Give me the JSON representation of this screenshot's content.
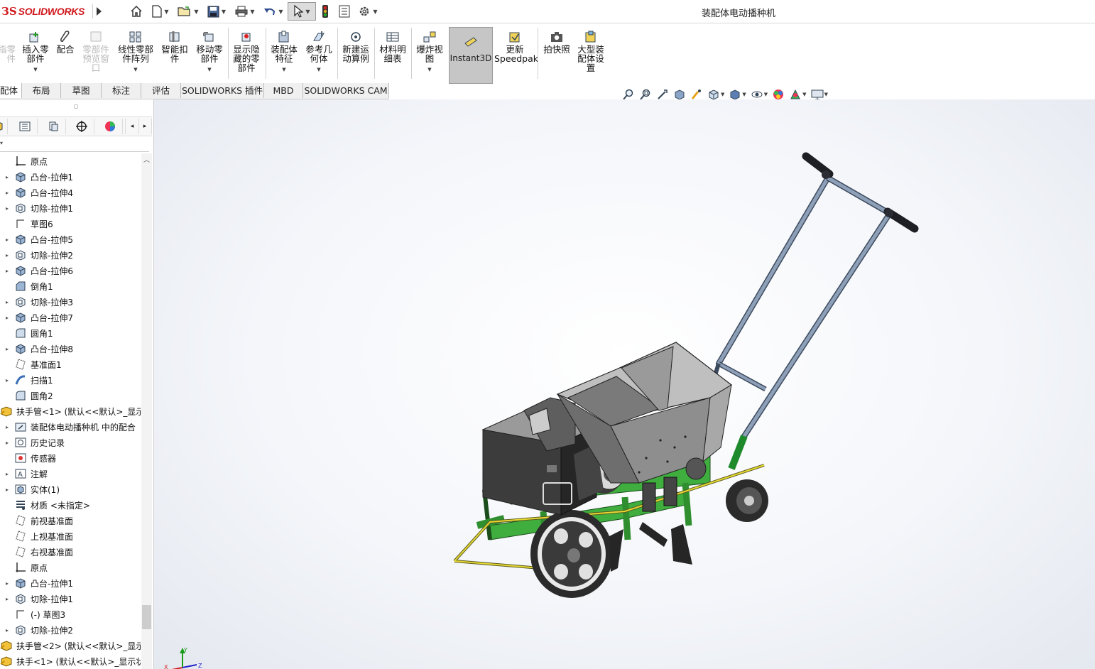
{
  "app": {
    "brand": "SOLIDWORKS",
    "window_title": "装配体电动播种机"
  },
  "colors": {
    "brand_red": "#d0191e",
    "frame_green": "#3fae3f",
    "hopper_gray": "#8e8e8e",
    "handle_blue": "#7d8fa8",
    "instant3d_bg": "#c6c6c6"
  },
  "quick_access": [
    {
      "name": "home-icon"
    },
    {
      "name": "new-document-icon"
    },
    {
      "name": "open-folder-icon"
    },
    {
      "name": "save-icon"
    },
    {
      "name": "print-icon"
    },
    {
      "name": "undo-icon"
    },
    {
      "name": "select-pointer-icon"
    },
    {
      "name": "rebuild-traffic-light-icon"
    },
    {
      "name": "file-properties-icon"
    },
    {
      "name": "options-gear-icon"
    }
  ],
  "ribbon": {
    "items": [
      {
        "label": "插入零部件",
        "lines": [
          "插入零",
          "部件"
        ]
      },
      {
        "label": "配合",
        "lines": [
          "配合"
        ]
      },
      {
        "label": "零部件预览窗口",
        "lines": [
          "零部件",
          "预览窗",
          "口"
        ]
      },
      {
        "label": "线性零部件阵列",
        "lines": [
          "线性零部",
          "件阵列"
        ]
      },
      {
        "label": "智能扣件",
        "lines": [
          "智能扣",
          "件"
        ]
      },
      {
        "label": "移动零部件",
        "lines": [
          "移动零",
          "部件"
        ]
      },
      {
        "label": "显示隐藏的零部件",
        "lines": [
          "显示隐",
          "藏的零",
          "部件"
        ]
      },
      {
        "label": "装配体特征",
        "lines": [
          "装配体",
          "特征"
        ]
      },
      {
        "label": "参考几何体",
        "lines": [
          "参考几",
          "何体"
        ]
      },
      {
        "label": "新建运动算例",
        "lines": [
          "新建运",
          "动算例"
        ]
      },
      {
        "label": "材料明细表",
        "lines": [
          "材料明",
          "细表"
        ]
      },
      {
        "label": "爆炸视图",
        "lines": [
          "爆炸视",
          "图"
        ]
      },
      {
        "label": "Instant3D",
        "lines": [
          "Instant3D"
        ]
      },
      {
        "label": "更新Speedpak",
        "lines": [
          "更新",
          "Speedpak"
        ]
      },
      {
        "label": "拍快照",
        "lines": [
          "拍快照"
        ]
      },
      {
        "label": "大型装配体设置",
        "lines": [
          "大型装",
          "配体设",
          "置"
        ]
      }
    ],
    "cut_left": [
      "指零",
      "件"
    ]
  },
  "tabs": [
    "配体",
    "布局",
    "草图",
    "标注",
    "评估",
    "SOLIDWORKS 插件",
    "MBD",
    "SOLIDWORKS CAM"
  ],
  "tree": {
    "items": [
      {
        "label": "原点",
        "icon": "origin-icon",
        "expand": false,
        "indent": 1
      },
      {
        "label": "凸台-拉伸1",
        "icon": "boss-extrude-icon",
        "expand": true,
        "indent": 1
      },
      {
        "label": "凸台-拉伸4",
        "icon": "boss-extrude-icon",
        "expand": true,
        "indent": 1
      },
      {
        "label": "切除-拉伸1",
        "icon": "cut-extrude-icon",
        "expand": true,
        "indent": 1
      },
      {
        "label": "草图6",
        "icon": "sketch-icon",
        "expand": false,
        "indent": 1
      },
      {
        "label": "凸台-拉伸5",
        "icon": "boss-extrude-icon",
        "expand": true,
        "indent": 1
      },
      {
        "label": "切除-拉伸2",
        "icon": "cut-extrude-icon",
        "expand": true,
        "indent": 1
      },
      {
        "label": "凸台-拉伸6",
        "icon": "boss-extrude-icon",
        "expand": true,
        "indent": 1
      },
      {
        "label": "倒角1",
        "icon": "chamfer-icon",
        "expand": false,
        "indent": 1
      },
      {
        "label": "切除-拉伸3",
        "icon": "cut-extrude-icon",
        "expand": true,
        "indent": 1
      },
      {
        "label": "凸台-拉伸7",
        "icon": "boss-extrude-icon",
        "expand": true,
        "indent": 1
      },
      {
        "label": "圆角1",
        "icon": "fillet-icon",
        "expand": false,
        "indent": 1
      },
      {
        "label": "凸台-拉伸8",
        "icon": "boss-extrude-icon",
        "expand": true,
        "indent": 1
      },
      {
        "label": "基准面1",
        "icon": "plane-icon",
        "expand": false,
        "indent": 1
      },
      {
        "label": "扫描1",
        "icon": "sweep-icon",
        "expand": true,
        "indent": 1
      },
      {
        "label": "圆角2",
        "icon": "fillet-icon",
        "expand": false,
        "indent": 1
      },
      {
        "label": "扶手管<1> (默认<<默认>_显示",
        "icon": "assembly-part-icon",
        "expand": false,
        "indent": 0
      },
      {
        "label": "装配体电动播种机 中的配合",
        "icon": "mates-folder-icon",
        "expand": true,
        "indent": 1
      },
      {
        "label": "历史记录",
        "icon": "history-icon",
        "expand": true,
        "indent": 1
      },
      {
        "label": "传感器",
        "icon": "sensor-icon",
        "expand": false,
        "indent": 1
      },
      {
        "label": "注解",
        "icon": "annotation-icon",
        "expand": true,
        "indent": 1
      },
      {
        "label": "实体(1)",
        "icon": "solid-bodies-icon",
        "expand": true,
        "indent": 1
      },
      {
        "label": "材质 <未指定>",
        "icon": "material-icon",
        "expand": false,
        "indent": 1
      },
      {
        "label": "前视基准面",
        "icon": "plane-icon",
        "expand": false,
        "indent": 1
      },
      {
        "label": "上视基准面",
        "icon": "plane-icon",
        "expand": false,
        "indent": 1
      },
      {
        "label": "右视基准面",
        "icon": "plane-icon",
        "expand": false,
        "indent": 1
      },
      {
        "label": "原点",
        "icon": "origin-icon",
        "expand": false,
        "indent": 1
      },
      {
        "label": "凸台-拉伸1",
        "icon": "boss-extrude-icon",
        "expand": true,
        "indent": 1
      },
      {
        "label": "切除-拉伸1",
        "icon": "cut-extrude-icon",
        "expand": true,
        "indent": 1
      },
      {
        "label": "(-) 草图3",
        "icon": "sketch-icon",
        "expand": false,
        "indent": 1
      },
      {
        "label": "切除-拉伸2",
        "icon": "cut-extrude-icon",
        "expand": true,
        "indent": 1
      },
      {
        "label": "扶手管<2> (默认<<默认>_显示",
        "icon": "assembly-part-icon",
        "expand": false,
        "indent": 0
      },
      {
        "label": "扶手<1> (默认<<默认>_显示状",
        "icon": "assembly-part-icon",
        "expand": false,
        "indent": 0
      }
    ]
  },
  "panel_tabs": [
    "feature-manager-icon",
    "property-manager-icon",
    "configuration-manager-icon",
    "dimxpert-icon",
    "display-manager-icon"
  ],
  "view_toolbar": [
    "zoom-to-fit-icon",
    "zoom-area-icon",
    "previous-view-icon",
    "section-view-icon",
    "dynamic-annotation-icon",
    "view-orientation-icon",
    "display-style-icon",
    "hide-show-icon",
    "edit-appearance-icon",
    "apply-scene-icon",
    "view-settings-icon"
  ]
}
